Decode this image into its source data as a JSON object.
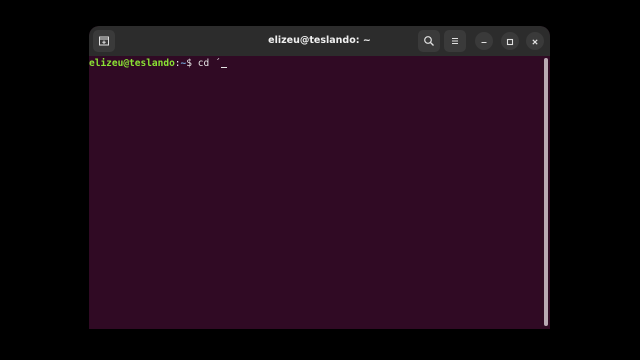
{
  "window": {
    "title": "elizeu@teslando: ~"
  },
  "toolbar": {
    "new_tab_icon": "new-tab-icon",
    "search_icon": "search-icon",
    "menu_icon": "hamburger-menu-icon",
    "minimize_icon": "minimize-icon",
    "maximize_icon": "maximize-icon",
    "close_icon": "close-icon"
  },
  "terminal": {
    "prompt_user": "elizeu@teslando",
    "prompt_sep": ":",
    "prompt_path": "~",
    "prompt_symbol": "$ ",
    "command": "cd ´"
  },
  "colors": {
    "background": "#300a24",
    "titlebar": "#2c2c2c",
    "prompt_user": "#8ae234",
    "prompt_path": "#729fcf",
    "text": "#e6e6e6"
  }
}
